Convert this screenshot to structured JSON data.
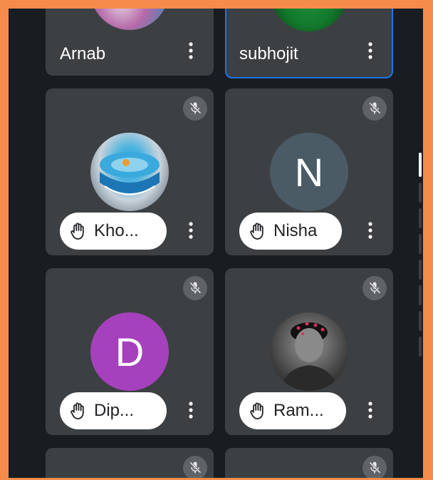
{
  "participants": [
    {
      "name": "Arnab",
      "avatar_type": "photo",
      "hand_raised": false,
      "muted": false,
      "active": false
    },
    {
      "name": "subhojit",
      "avatar_type": "photo",
      "hand_raised": false,
      "muted": false,
      "active": true
    },
    {
      "name": "Kho...",
      "avatar_type": "photo",
      "hand_raised": true,
      "muted": true,
      "active": false
    },
    {
      "name": "Nisha",
      "avatar_type": "letter",
      "letter": "N",
      "avatar_color": "#4a5b66",
      "hand_raised": true,
      "muted": true,
      "active": false
    },
    {
      "name": "Dip...",
      "avatar_type": "letter",
      "letter": "D",
      "avatar_color": "#a541bd",
      "hand_raised": true,
      "muted": true,
      "active": false
    },
    {
      "name": "Ram...",
      "avatar_type": "photo",
      "hand_raised": true,
      "muted": true,
      "active": false
    }
  ],
  "icons": {
    "muted": "mic-off-icon",
    "hand": "raised-hand-icon",
    "more": "more-vert-icon"
  },
  "colors": {
    "background": "#191c21",
    "tile": "#3c4043",
    "active_border": "#1a73e8",
    "frame": "#f58c4b"
  }
}
